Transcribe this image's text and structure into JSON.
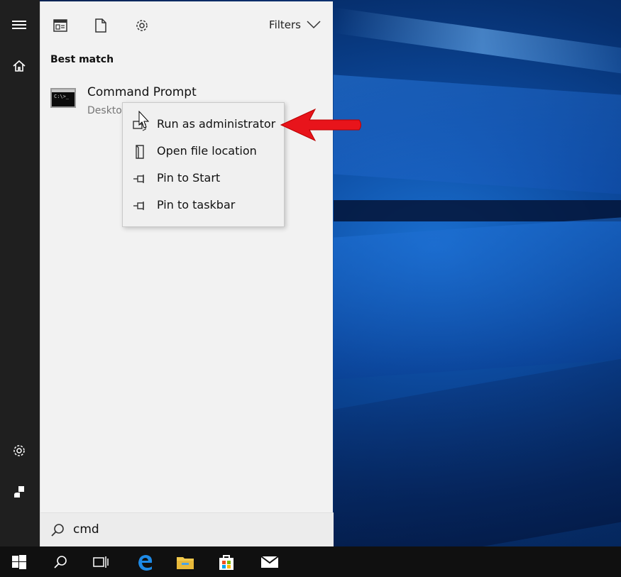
{
  "topbar": {
    "filters_label": "Filters",
    "icons": [
      "apps-icon",
      "document-icon",
      "settings-icon",
      "chevron-down-icon"
    ]
  },
  "section_label": "Best match",
  "result": {
    "title": "Command Prompt",
    "subtitle": "Deskto",
    "icon_text": "C:\\>_"
  },
  "context_menu": {
    "items": [
      {
        "label": "Run as administrator",
        "icon": "run-as-admin-icon"
      },
      {
        "label": "Open file location",
        "icon": "file-location-icon"
      },
      {
        "label": "Pin to Start",
        "icon": "pin-icon"
      },
      {
        "label": "Pin to taskbar",
        "icon": "pin-icon"
      }
    ]
  },
  "search": {
    "query": "cmd"
  },
  "rail": {
    "icons": [
      "hamburger-icon",
      "home-icon",
      "settings-icon",
      "user-icon"
    ]
  },
  "taskbar": {
    "icons": [
      "windows-start-icon",
      "search-icon",
      "task-view-icon",
      "edge-icon",
      "file-explorer-icon",
      "store-icon",
      "mail-icon"
    ]
  },
  "colors": {
    "annotation_arrow": "#e8141b",
    "panel_bg": "#f2f2f2",
    "rail_bg": "#1f1f1f",
    "taskbar_bg": "#101010"
  }
}
